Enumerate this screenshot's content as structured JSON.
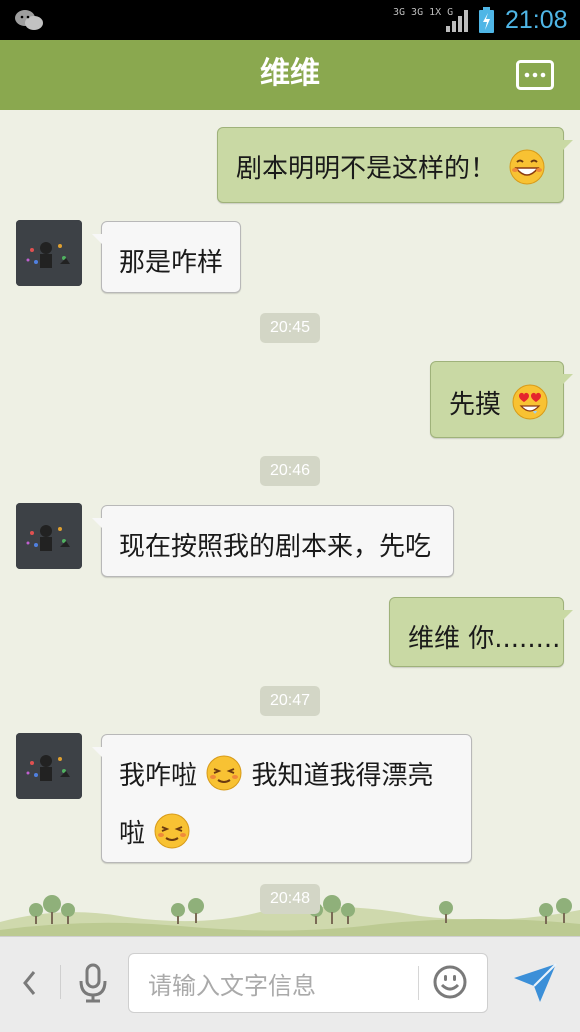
{
  "status_bar": {
    "network_top": "3G 3G 1X G",
    "time": "21:08"
  },
  "header": {
    "title": "维维"
  },
  "messages": [
    {
      "side": "out",
      "text": "剧本明明不是这样的！",
      "emoji": "grin-emoji"
    },
    {
      "side": "in",
      "text": "那是咋样"
    },
    {
      "side": "time",
      "text": "20:45"
    },
    {
      "side": "out",
      "text": "先摸",
      "emoji": "heart-eyes-emoji"
    },
    {
      "side": "time",
      "text": "20:46"
    },
    {
      "side": "in",
      "text": "现在按照我的剧本来，先吃"
    },
    {
      "side": "out",
      "text": "维维 你........"
    },
    {
      "side": "time",
      "text": "20:47"
    },
    {
      "side": "in",
      "line1_a": "我咋啦",
      "line1_b": "我知道我得漂亮",
      "line2": "啦",
      "emoji": "content-emoji"
    },
    {
      "side": "time",
      "text": "20:48"
    }
  ],
  "input": {
    "placeholder": "请输入文字信息"
  },
  "colors": {
    "header": "#8aa84f",
    "outgoing_bubble": "#c9d9a4",
    "incoming_bubble": "#f7f7f7",
    "time_accent": "#4fb6e6",
    "send": "#3b8fd8"
  }
}
